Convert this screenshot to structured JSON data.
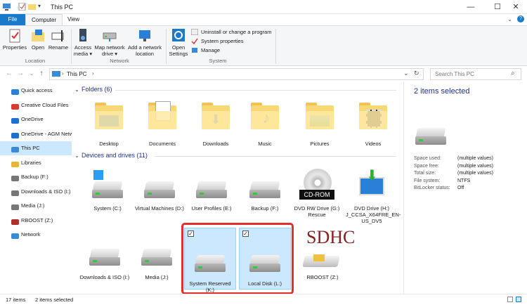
{
  "window": {
    "title": "This PC",
    "minimize": "—",
    "maximize": "☐",
    "close": "✕"
  },
  "tabs": {
    "file": "File",
    "computer": "Computer",
    "view": "View"
  },
  "ribbon": {
    "properties": "Properties",
    "open": "Open",
    "rename": "Rename",
    "access_media": "Access media ▾",
    "map_network_drive": "Map network drive ▾",
    "add_network_location": "Add a network location",
    "open_settings": "Open Settings",
    "uninstall": "Uninstall or change a program",
    "system_properties": "System properties",
    "manage": "Manage",
    "group_location": "Location",
    "group_network": "Network",
    "group_system": "System"
  },
  "address": {
    "path": "This PC",
    "search_placeholder": "Search This PC"
  },
  "nav": [
    {
      "label": "Quick access",
      "icon": "star-icon",
      "color": "#2a7fd6"
    },
    {
      "label": "Creative Cloud Files",
      "icon": "cloud-icon",
      "color": "#da3b2f"
    },
    {
      "label": "OneDrive",
      "icon": "cloud-icon",
      "color": "#1f6fd0"
    },
    {
      "label": "OneDrive - AGM Networks",
      "icon": "cloud-icon",
      "color": "#1f6fd0"
    },
    {
      "label": "This PC",
      "icon": "monitor-icon",
      "color": "#3a8ad8"
    },
    {
      "label": "Libraries",
      "icon": "library-icon",
      "color": "#e8b43a"
    },
    {
      "label": "Backup (F:)",
      "icon": "drive-icon",
      "color": "#777777"
    },
    {
      "label": "Downloads & ISO (I:)",
      "icon": "drive-icon",
      "color": "#777777"
    },
    {
      "label": "Media (J:)",
      "icon": "drive-icon",
      "color": "#777777"
    },
    {
      "label": "RBOOST (Z:)",
      "icon": "sd-card-icon",
      "color": "#b03030"
    },
    {
      "label": "Network",
      "icon": "network-icon",
      "color": "#3a8ad8"
    }
  ],
  "content": {
    "folders_header": "Folders (6)",
    "folders": [
      {
        "label": "Desktop",
        "icon": "desktop-folder-icon"
      },
      {
        "label": "Documents",
        "icon": "documents-folder-icon"
      },
      {
        "label": "Downloads",
        "icon": "downloads-folder-icon"
      },
      {
        "label": "Music",
        "icon": "music-folder-icon"
      },
      {
        "label": "Pictures",
        "icon": "pictures-folder-icon"
      },
      {
        "label": "Videos",
        "icon": "videos-folder-icon"
      }
    ],
    "drives_header": "Devices and drives (11)",
    "drives_row1": [
      {
        "label": "System (C:)",
        "icon": "windows-drive-icon"
      },
      {
        "label": "Virtual Machines (D:)",
        "icon": "drive-icon"
      },
      {
        "label": "User Profiles (E:)",
        "icon": "drive-icon"
      },
      {
        "label": "Backup (F:)",
        "icon": "drive-icon"
      },
      {
        "label": "DVD RW Drive (G:) Rescue",
        "icon": "cd-rom-icon",
        "badge": "CD-ROM"
      },
      {
        "label": "DVD Drive (H:) J_CCSA_X64FRE_EN-US_DV5",
        "icon": "dvd-install-icon"
      }
    ],
    "drives_row2": [
      {
        "label": "Downloads & ISO (I:)",
        "icon": "drive-icon",
        "selected": false
      },
      {
        "label": "Media (J:)",
        "icon": "drive-icon",
        "selected": false
      },
      {
        "label": "System Reserved (K:)",
        "icon": "drive-icon",
        "selected": true
      },
      {
        "label": "Local Disk (L:)",
        "icon": "drive-icon",
        "selected": true
      },
      {
        "label": "RBOOST (Z:)",
        "icon": "sd-card-icon",
        "badge": "SDHC",
        "selected": false
      }
    ]
  },
  "details": {
    "title": "2 items selected",
    "rows": [
      {
        "k": "Space used:",
        "v": "(multiple values)"
      },
      {
        "k": "Space free:",
        "v": "(multiple values)"
      },
      {
        "k": "Total size:",
        "v": "(multiple values)"
      },
      {
        "k": "File system:",
        "v": "NTFS"
      },
      {
        "k": "BitLocker status:",
        "v": "Off"
      }
    ]
  },
  "status": {
    "items": "17 items",
    "selected": "2 items selected"
  },
  "colors": {
    "accent": "#1979ca",
    "selection": "#cce8ff",
    "highlight_box": "#e03030",
    "header_blue": "#1e3287"
  }
}
